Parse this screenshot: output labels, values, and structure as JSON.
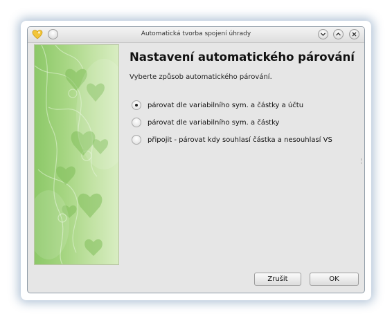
{
  "window": {
    "title": "Automatická tvorba spojení úhrady"
  },
  "titlebar_buttons": {
    "minimize_icon": "chevron-down-icon",
    "maximize_icon": "chevron-up-icon",
    "close_icon": "close-icon"
  },
  "main": {
    "heading": "Nastavení automatického párování",
    "subtitle": "Vyberte způsob automatického párování.",
    "options": [
      {
        "label": "párovat dle variabilního sym. a částky a účtu",
        "checked": true
      },
      {
        "label": "párovat dle variabilního sym. a částky",
        "checked": false
      },
      {
        "label": "připojit - párovat kdy souhlasí částka a nesouhlasí VS",
        "checked": false
      }
    ]
  },
  "buttons": {
    "cancel_label": "Zrušit",
    "ok_label": "OK"
  },
  "colors": {
    "accent_green": "#a5d581",
    "window_bg": "#e6e6e6"
  }
}
